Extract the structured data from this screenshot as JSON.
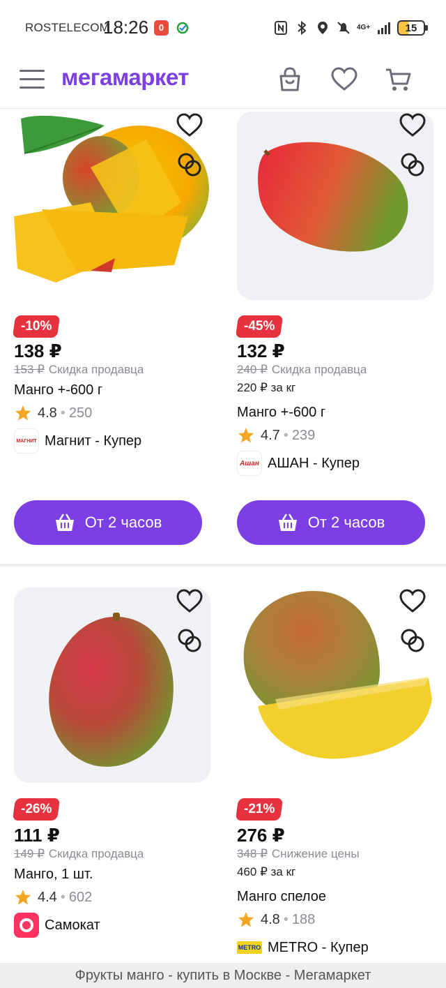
{
  "status_bar": {
    "carrier": "ROSTELECOM",
    "time": "18:26",
    "notif_badge": "0",
    "network": "4G+",
    "battery": "15"
  },
  "header": {
    "logo": "мегамаркет",
    "icons": [
      "menu-icon",
      "bag-icon",
      "heart-icon",
      "cart-icon"
    ]
  },
  "colors": {
    "brand": "#7b3fe4",
    "discount": "#e6323f"
  },
  "products": [
    {
      "discount": "-10%",
      "price": "138 ₽",
      "old_price": "153 ₽",
      "discount_note": "Скидка продавца",
      "price_per_kg": "",
      "title": "Манго +-600 г",
      "rating": "4.8",
      "reviews": "250",
      "store": "Магнит - Купер",
      "store_logo_text": "МАГНИТ",
      "button": "От 2 часов"
    },
    {
      "discount": "-45%",
      "price": "132 ₽",
      "old_price": "240 ₽",
      "discount_note": "Скидка продавца",
      "price_per_kg": "220 ₽ за кг",
      "title": "Манго +-600 г",
      "rating": "4.7",
      "reviews": "239",
      "store": "АШАН - Купер",
      "store_logo_text": "Ашан",
      "button": "От 2 часов"
    },
    {
      "discount": "-26%",
      "price": "111 ₽",
      "old_price": "149 ₽",
      "discount_note": "Скидка продавца",
      "price_per_kg": "",
      "title": "Манго, 1 шт.",
      "rating": "4.4",
      "reviews": "602",
      "store": "Самокат",
      "store_logo_text": "",
      "button": ""
    },
    {
      "discount": "-21%",
      "price": "276 ₽",
      "old_price": "348 ₽",
      "discount_note": "Снижение цены",
      "price_per_kg": "460 ₽ за кг",
      "title": "Манго спелое",
      "rating": "4.8",
      "reviews": "188",
      "store": "METRO - Купер",
      "store_logo_text": "METRO",
      "button": ""
    }
  ],
  "footer": {
    "page_title": "Фрукты манго - купить в Москве - Мегамаркет"
  }
}
